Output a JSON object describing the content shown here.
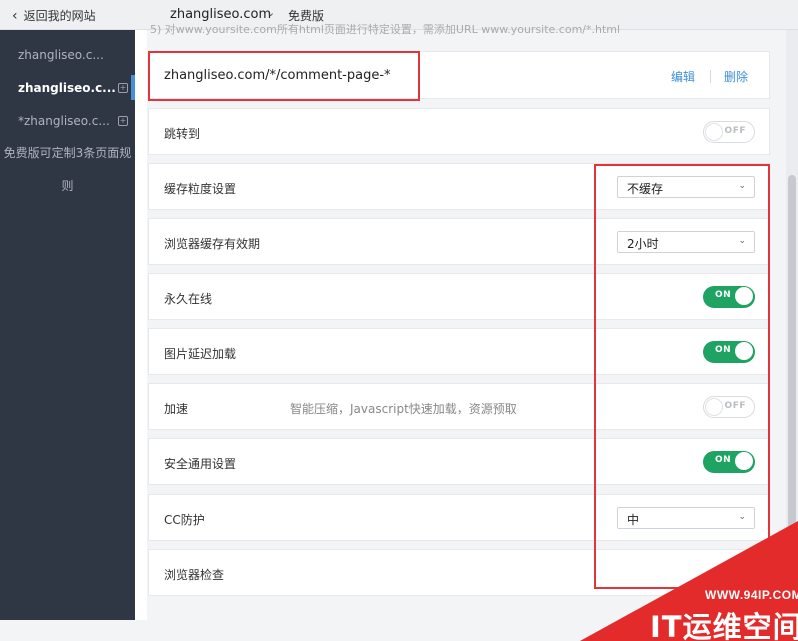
{
  "topbar": {
    "back_label": "返回我的网站",
    "site": "zhangliseo.com",
    "plan": "免费版"
  },
  "sidebar": {
    "items": [
      {
        "label": "zhangliseo.c..."
      },
      {
        "label": "zhangliseo.c..."
      },
      {
        "label": "*zhangliseo.c..."
      }
    ],
    "note_line1": "免费版可定制3条页面规",
    "note_line2": "则"
  },
  "header_text": "5) 对www.yoursite.com所有html页面进行特定设置，需添加URL www.yoursite.com/*.html",
  "rule": {
    "url": "zhangliseo.com/*/comment-page-*",
    "edit_label": "编辑",
    "delete_label": "删除"
  },
  "settings": [
    {
      "label": "跳转到",
      "type": "toggle",
      "state": "OFF"
    },
    {
      "label": "缓存粒度设置",
      "type": "select",
      "value": "不缓存"
    },
    {
      "label": "浏览器缓存有效期",
      "type": "select",
      "value": "2小时"
    },
    {
      "label": "永久在线",
      "type": "toggle",
      "state": "ON"
    },
    {
      "label": "图片延迟加载",
      "type": "toggle",
      "state": "ON"
    },
    {
      "label": "加速",
      "desc": "智能压缩，Javascript快速加载，资源预取",
      "type": "toggle",
      "state": "OFF"
    },
    {
      "label": "安全通用设置",
      "type": "toggle",
      "state": "ON"
    },
    {
      "label": "CC防护",
      "type": "select",
      "value": "中"
    },
    {
      "label": "浏览器检查"
    }
  ],
  "watermark": {
    "url": "WWW.94IP.COM",
    "text": "IT运维空间"
  },
  "colors": {
    "sidebar_bg": "#2f3744",
    "toggle_on": "#1ea363",
    "link": "#3b8fd6",
    "highlight_box": "#e2343b",
    "watermark": "#e32b2b"
  }
}
